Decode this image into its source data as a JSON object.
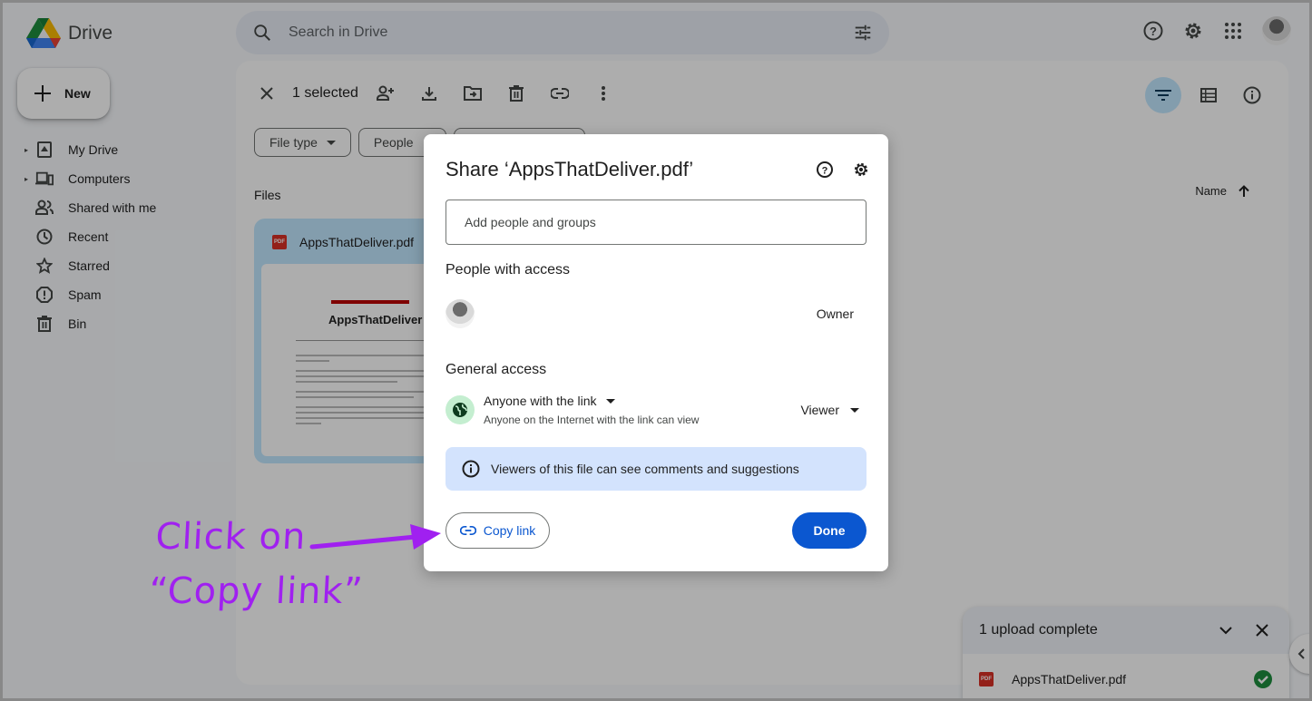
{
  "app": {
    "name": "Drive",
    "colors": {
      "accent": "#0b57d0",
      "filter_active": "#c2e7ff",
      "annotation": "#a020f0",
      "info_bg": "#d3e3fd",
      "success": "#1e8e3e"
    }
  },
  "header": {
    "search_placeholder": "Search in Drive",
    "icons": [
      "search-icon",
      "search-options-icon",
      "help-icon",
      "settings-icon",
      "apps-grid-icon",
      "account-avatar"
    ]
  },
  "sidebar": {
    "new_label": "New",
    "items": [
      {
        "label": "My Drive",
        "icon": "my-drive-icon",
        "expandable": true
      },
      {
        "label": "Computers",
        "icon": "computers-icon",
        "expandable": true
      },
      {
        "label": "Shared with me",
        "icon": "shared-icon",
        "expandable": false
      },
      {
        "label": "Recent",
        "icon": "clock-icon",
        "expandable": false
      },
      {
        "label": "Starred",
        "icon": "star-icon",
        "expandable": false
      },
      {
        "label": "Spam",
        "icon": "spam-icon",
        "expandable": false
      },
      {
        "label": "Bin",
        "icon": "trash-icon",
        "expandable": false
      }
    ]
  },
  "main": {
    "selection_text": "1 selected",
    "filters": [
      {
        "label": "File type"
      },
      {
        "label": "People"
      },
      {
        "label": ""
      }
    ],
    "section_label": "Files",
    "sort_label": "Name",
    "file": {
      "name": "AppsThatDeliver.pdf",
      "type_badge": "PDF",
      "thumb_heading": "AppsThatDeliver"
    }
  },
  "share_dialog": {
    "title": "Share ‘AppsThatDeliver.pdf’",
    "add_placeholder": "Add people and groups",
    "people_heading": "People with access",
    "owner_role": "Owner",
    "general_heading": "General access",
    "access_option": "Anyone with the link",
    "access_description": "Anyone on the Internet with the link can view",
    "access_role": "Viewer",
    "info_text": "Viewers of this file can see comments and suggestions",
    "copy_link_label": "Copy link",
    "done_label": "Done"
  },
  "upload_panel": {
    "title": "1 upload complete",
    "file_name": "AppsThatDeliver.pdf",
    "type_badge": "PDF",
    "status": "complete"
  },
  "annotation": {
    "line1": "Click on",
    "line2": "“Copy link”"
  }
}
